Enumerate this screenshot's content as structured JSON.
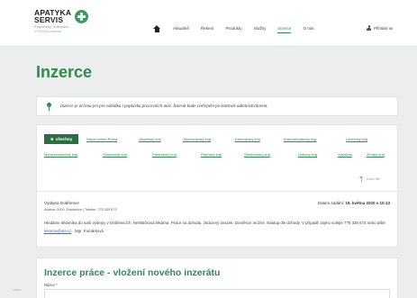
{
  "brand": {
    "name_line1": "APATYKA",
    "name_line2": "SERVIS",
    "tagline": "Pharmacy Software",
    "subtagline": "a POHODA company",
    "accent": "#2f8b50"
  },
  "nav": {
    "items": [
      {
        "label": "Aktuálně"
      },
      {
        "label": "Řešení"
      },
      {
        "label": "Produkty"
      },
      {
        "label": "Služby"
      },
      {
        "label": "Inzerce"
      },
      {
        "label": "O nás"
      }
    ],
    "active": "Inzerce",
    "login_label": "Přihlásit se"
  },
  "page": {
    "title": "Inzerce"
  },
  "info": {
    "text": "Inzerce je určena jen pro nabídku i poptávku pracovních míst. Inzerát bude zveřejněn po kontrole administrátorem."
  },
  "filters": {
    "all_label": "všechny",
    "row1": [
      "Hlavní město Praha",
      "Jihočeský kraj",
      "Jihomoravský kraj",
      "Karlovarský kraj",
      "Královéhradecký kraj",
      "Liberecký kraj"
    ],
    "row2": [
      "Moravskoslezský kraj",
      "Olomoucký kraj",
      "Pardubický kraj",
      "Plzeňský kraj",
      "Středočeský kraj",
      "Ústecký kraj",
      "Vysočina",
      "Zlínský kraj"
    ],
    "funnel_label": "Další filtr"
  },
  "ad": {
    "company": "Výdejna Dobřenice",
    "address": "Adresa: 0000, Dobřenice | Telefon: 775 330 673",
    "date_label": "Datum zadání:",
    "date_value": "19. května 2020 v 10:13",
    "text_before": "Hledáme lékárníka do naší výdejny v Dobřenicích. Nehtitičková lékárna. Práce na dohodu, zkrácený úvazek. Doměsce možné. Nástup dle dohody. V případě zájmu volejte 775 330 673 nebo pište",
    "email": "lekarna@ula.cz",
    "text_after": ". Mgr. Komárková"
  },
  "form": {
    "title": "Inzerce práce - vložení nového inzerátu",
    "name_label": "Název *"
  }
}
